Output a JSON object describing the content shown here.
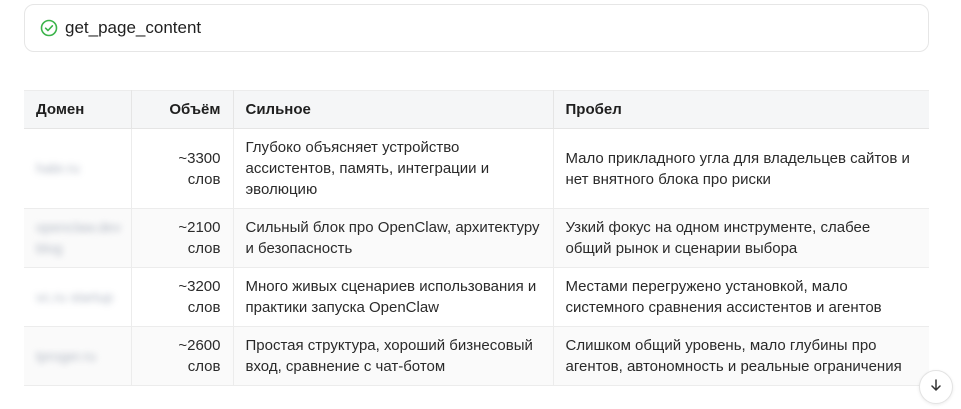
{
  "tool_call": {
    "name": "get_page_content",
    "status_icon": "check-circle-icon",
    "status_color": "#3bb34a"
  },
  "table": {
    "headers": [
      "Домен",
      "Объём",
      "Сильное",
      "Пробел"
    ],
    "rows": [
      {
        "domain": "habr.ru",
        "volume": "~3300 слов",
        "strong": "Глубоко объясняет устройство ассистентов, память, интеграции и эволюцию",
        "gap": "Мало прикладного угла для владельцев сайтов и нет внятного блока про риски"
      },
      {
        "domain": "openclaw.dev blog",
        "volume": "~2100 слов",
        "strong": "Сильный блок про OpenClaw, архитектуру и безопасность",
        "gap": "Узкий фокус на одном инструменте, слабее общий рынок и сценарии выбора"
      },
      {
        "domain": "vc.ru startup",
        "volume": "~3200 слов",
        "strong": "Много живых сценариев использования и практики запуска OpenClaw",
        "gap": "Местами перегружено установкой, мало системного сравнения ассистентов и агентов"
      },
      {
        "domain": "tproger.ru",
        "volume": "~2600 слов",
        "strong": "Простая структура, хороший бизнесовый вход, сравнение с чат-ботом",
        "gap": "Слишком общий уровень, мало глубины про агентов, автономность и реальные ограничения"
      }
    ]
  },
  "scroll_button": {
    "icon": "arrow-down-icon"
  }
}
